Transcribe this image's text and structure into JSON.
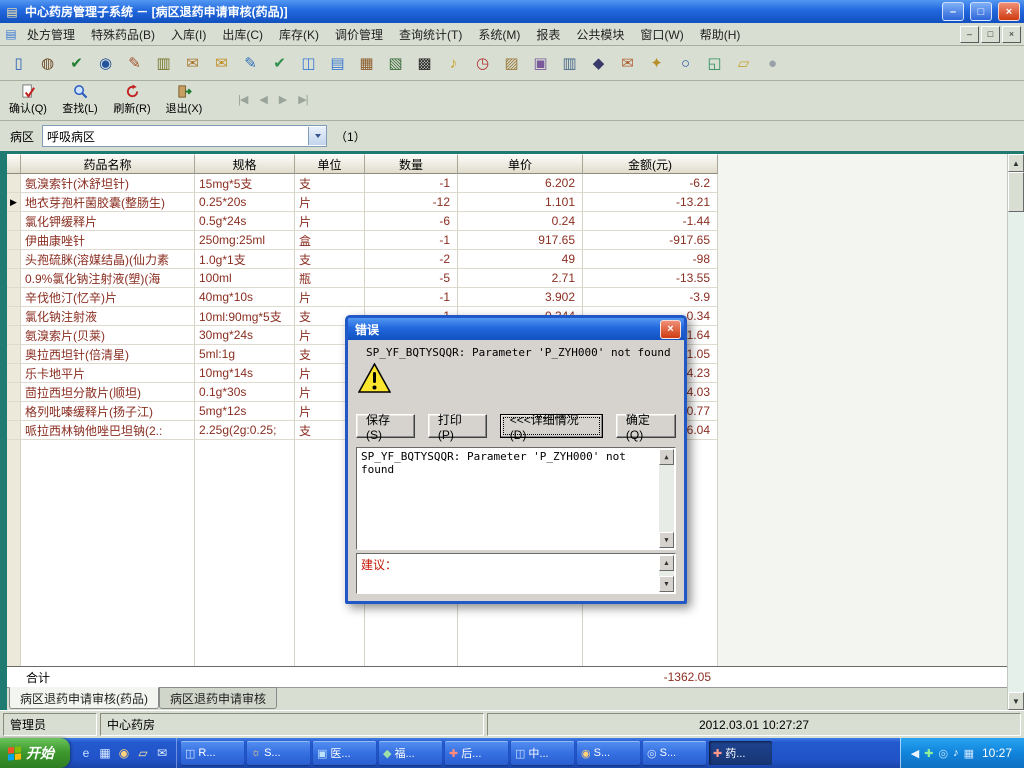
{
  "colors": {
    "accent_blue": "#2268DE",
    "negative_red": "#8B2E21",
    "desktop_teal": "#1F7A72",
    "taskbar_blue": "#2459CE",
    "start_green": "#3E9A2E"
  },
  "window": {
    "title": "中心药房管理子系统 － [病区退药申请审核(药品)]",
    "minimize": "–",
    "restore": "□",
    "close": "×"
  },
  "menu": {
    "items": [
      "处方管理",
      "特殊药品(B)",
      "入库(I)",
      "出库(C)",
      "库存(K)",
      "调价管理",
      "查询统计(T)",
      "系统(M)",
      "报表",
      "公共模块",
      "窗口(W)",
      "帮助(H)"
    ]
  },
  "toolbar": {
    "icons": [
      {
        "name": "new-doc-icon",
        "glyph": "▯",
        "color": "#2F62B8"
      },
      {
        "name": "ink-bottle-icon",
        "glyph": "◍",
        "color": "#6B4A26"
      },
      {
        "name": "approve-icon",
        "glyph": "✔",
        "color": "#1F7F2F"
      },
      {
        "name": "binoculars-icon",
        "glyph": "◉",
        "color": "#24539E"
      },
      {
        "name": "audit-icon",
        "glyph": "✎",
        "color": "#A0522D"
      },
      {
        "name": "money-icon",
        "glyph": "▥",
        "color": "#77772A"
      },
      {
        "name": "mail-audit-icon",
        "glyph": "✉",
        "color": "#A8762A"
      },
      {
        "name": "mail-icon",
        "glyph": "✉",
        "color": "#C08A20"
      },
      {
        "name": "doc-edit-icon",
        "glyph": "✎",
        "color": "#2F6EB5"
      },
      {
        "name": "doc-check-icon",
        "glyph": "✔",
        "color": "#2F8F4F"
      },
      {
        "name": "copy-icon",
        "glyph": "◫",
        "color": "#3A7AD4"
      },
      {
        "name": "doc-blue-icon",
        "glyph": "▤",
        "color": "#3A7AD4"
      },
      {
        "name": "form-edit-icon",
        "glyph": "▦",
        "color": "#8A5A2A"
      },
      {
        "name": "ledger-icon",
        "glyph": "▧",
        "color": "#3A6A3A"
      },
      {
        "name": "barcode-icon",
        "glyph": "▩",
        "color": "#222222"
      },
      {
        "name": "bell-icon",
        "glyph": "♪",
        "color": "#C8A020"
      },
      {
        "name": "alarm-icon",
        "glyph": "◷",
        "color": "#B03030"
      },
      {
        "name": "package-icon",
        "glyph": "▨",
        "color": "#9A7A3A"
      },
      {
        "name": "cabinet-icon",
        "glyph": "▣",
        "color": "#7A5A9A"
      },
      {
        "name": "bank-icon",
        "glyph": "▥",
        "color": "#4A6A8A"
      },
      {
        "name": "safe-icon",
        "glyph": "◆",
        "color": "#3A3A6A"
      },
      {
        "name": "mail-open-icon",
        "glyph": "✉",
        "color": "#B06030"
      },
      {
        "name": "key-icon",
        "glyph": "✦",
        "color": "#B8902A"
      },
      {
        "name": "search-icon",
        "glyph": "○",
        "color": "#24539E"
      },
      {
        "name": "export-icon",
        "glyph": "◱",
        "color": "#2F8F5F"
      },
      {
        "name": "folder-open-icon",
        "glyph": "▱",
        "color": "#C8A030"
      },
      {
        "name": "globe-icon",
        "glyph": "●",
        "color": "#9AA0A8"
      }
    ]
  },
  "toolbar2": {
    "buttons": [
      {
        "label": "确认(Q)"
      },
      {
        "label": "查找(L)"
      },
      {
        "label": "刷新(R)"
      },
      {
        "label": "退出(X)"
      }
    ],
    "nav": [
      "|◀",
      "◀",
      "▶",
      "▶|"
    ]
  },
  "filter": {
    "label": "病区",
    "value": "呼吸病区",
    "count": "（1）"
  },
  "table": {
    "headers": [
      "药品名称",
      "规格",
      "单位",
      "数量",
      "单价",
      "金额(元)"
    ],
    "rows": [
      {
        "name": "氨溴索针(沐舒坦针)",
        "spec": "15mg*5支",
        "unit": "支",
        "qty": "-1",
        "price": "6.202",
        "amount": "-6.2"
      },
      {
        "name": "地衣芽孢杆菌胶囊(整肠生)",
        "spec": "0.25*20s",
        "unit": "片",
        "qty": "-12",
        "price": "1.101",
        "amount": "-13.21",
        "current": true
      },
      {
        "name": "氯化钾缓释片",
        "spec": "0.5g*24s",
        "unit": "片",
        "qty": "-6",
        "price": "0.24",
        "amount": "-1.44"
      },
      {
        "name": "伊曲康唑针",
        "spec": "250mg:25ml",
        "unit": "盒",
        "qty": "-1",
        "price": "917.65",
        "amount": "-917.65"
      },
      {
        "name": "头孢硫脒(溶媒结晶)(仙力素",
        "spec": "1.0g*1支",
        "unit": "支",
        "qty": "-2",
        "price": "49",
        "amount": "-98"
      },
      {
        "name": "0.9%氯化钠注射液(塑)(海",
        "spec": "100ml",
        "unit": "瓶",
        "qty": "-5",
        "price": "2.71",
        "amount": "-13.55"
      },
      {
        "name": "辛伐他汀(忆辛)片",
        "spec": "40mg*10s",
        "unit": "片",
        "qty": "-1",
        "price": "3.902",
        "amount": "-3.9"
      },
      {
        "name": "氯化钠注射液",
        "spec": "10ml:90mg*5支",
        "unit": "支",
        "qty": "-1",
        "price": "0.344",
        "amount": "-0.34"
      },
      {
        "name": "氨溴索片(贝莱)",
        "spec": "30mg*24s",
        "unit": "片",
        "qty": "",
        "price": "",
        "amount": "-1.64"
      },
      {
        "name": "奥拉西坦针(倍清星)",
        "spec": "5ml:1g",
        "unit": "支",
        "qty": "",
        "price": "",
        "amount": "151.05"
      },
      {
        "name": "乐卡地平片",
        "spec": "10mg*14s",
        "unit": "片",
        "qty": "",
        "price": "",
        "amount": "-4.23"
      },
      {
        "name": "茴拉西坦分散片(顺坦)",
        "spec": "0.1g*30s",
        "unit": "片",
        "qty": "",
        "price": "",
        "amount": "-4.03"
      },
      {
        "name": "格列吡嗪缓释片(扬子江)",
        "spec": "5mg*12s",
        "unit": "片",
        "qty": "",
        "price": "",
        "amount": "-0.77"
      },
      {
        "name": "哌拉西林钠他唑巴坦钠(2.:",
        "spec": "2.25g(2g:0.25;",
        "unit": "支",
        "qty": "",
        "price": "",
        "amount": "146.04"
      }
    ],
    "total_label": "合计",
    "total_amount": "-1362.05"
  },
  "dialog": {
    "title": "错误",
    "close": "×",
    "message": "SP_YF_BQTYSQQR: Parameter 'P_ZYH000' not found",
    "buttons": [
      "保存(S)",
      "打印(P)",
      "<<<详细情况(D)",
      "确定(Q)"
    ],
    "detail_text": "SP_YF_BQTYSQQR: Parameter 'P_ZYH000' not found",
    "suggestion_label": "建议："
  },
  "tabs": [
    "病区退药申请审核(药品)",
    "病区退药申请审核"
  ],
  "statusbar": {
    "user": "管理员",
    "department": "中心药房",
    "datetime": "2012.03.01 10:27:27"
  },
  "taskbar": {
    "start_label": "开始",
    "quick": [
      {
        "name": "ie-icon",
        "glyph": "e",
        "color": "#BFE0FF"
      },
      {
        "name": "show-desktop-icon",
        "glyph": "▦",
        "color": "#D7E8FF"
      },
      {
        "name": "media-player-icon",
        "glyph": "◉",
        "color": "#FFD27A"
      },
      {
        "name": "folder-icon",
        "glyph": "▱",
        "color": "#FFE9A8"
      },
      {
        "name": "mail-icon",
        "glyph": "✉",
        "color": "#DFF0FF"
      }
    ],
    "tasks": [
      {
        "label": "R...",
        "glyph": "◫",
        "icon_name": "window-icon",
        "color": "#CFE0FF"
      },
      {
        "label": "S...",
        "glyph": "☼",
        "icon_name": "settings-icon",
        "color": "#FFD27A"
      },
      {
        "label": "医...",
        "glyph": "▣",
        "icon_name": "hospital-app-icon",
        "color": "#BFE3FF"
      },
      {
        "label": "福...",
        "glyph": "◆",
        "icon_name": "app-icon",
        "color": "#9FE0A8"
      },
      {
        "label": "后...",
        "glyph": "✚",
        "icon_name": "red-cross-icon",
        "color": "#FF8A7A"
      },
      {
        "label": "中...",
        "glyph": "◫",
        "icon_name": "window-icon",
        "color": "#CFE0FF"
      },
      {
        "label": "S...",
        "glyph": "◉",
        "icon_name": "app-icon",
        "color": "#FFD27A"
      },
      {
        "label": "S...",
        "glyph": "◎",
        "icon_name": "app-icon",
        "color": "#D7E8FF"
      },
      {
        "label": "药...",
        "glyph": "✚",
        "icon_name": "pharmacy-app-icon",
        "color": "#FF9A8A",
        "active": true
      }
    ],
    "tray_icons": [
      {
        "name": "chevron-left-icon",
        "glyph": "◀",
        "color": "#EAF4FF"
      },
      {
        "name": "shield-icon",
        "glyph": "✚",
        "color": "#8FF09A"
      },
      {
        "name": "messenger-icon",
        "glyph": "◎",
        "color": "#BFE3FF"
      },
      {
        "name": "volume-icon",
        "glyph": "♪",
        "color": "#FFFFFF"
      },
      {
        "name": "network-icon",
        "glyph": "▦",
        "color": "#CFE6FF"
      }
    ],
    "tray_time": "10:27"
  }
}
